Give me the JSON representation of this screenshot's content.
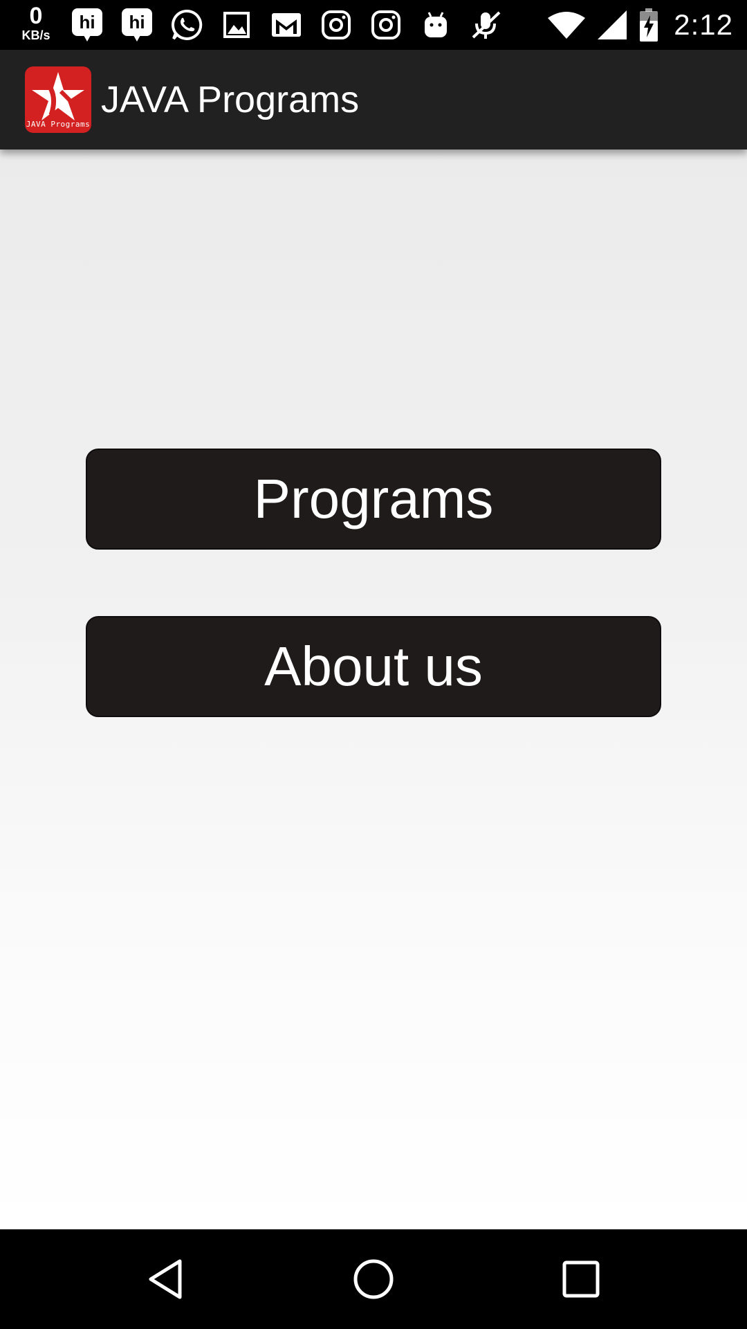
{
  "status_bar": {
    "net_speed_value": "0",
    "net_speed_unit": "KB/s",
    "time": "2:12",
    "notification_icons": [
      "hike-messenger-icon",
      "hike-messenger-icon",
      "whatsapp-icon",
      "image-icon",
      "gmail-icon",
      "instagram-icon",
      "instagram-icon",
      "android-debug-icon",
      "muted-microphone-icon"
    ],
    "system_icons": [
      "wifi-icon",
      "cell-signal-icon",
      "battery-charging-icon"
    ]
  },
  "app_bar": {
    "title": "JAVA Programs",
    "logo_text": "JAVA Programs",
    "logo_color": "#d32021",
    "background": "#212121"
  },
  "main": {
    "buttons": [
      {
        "label": "Programs"
      },
      {
        "label": "About us"
      }
    ],
    "button_color": "#1f1b1a"
  },
  "nav_bar": {
    "buttons": [
      "back-icon",
      "home-icon",
      "recents-icon"
    ]
  }
}
